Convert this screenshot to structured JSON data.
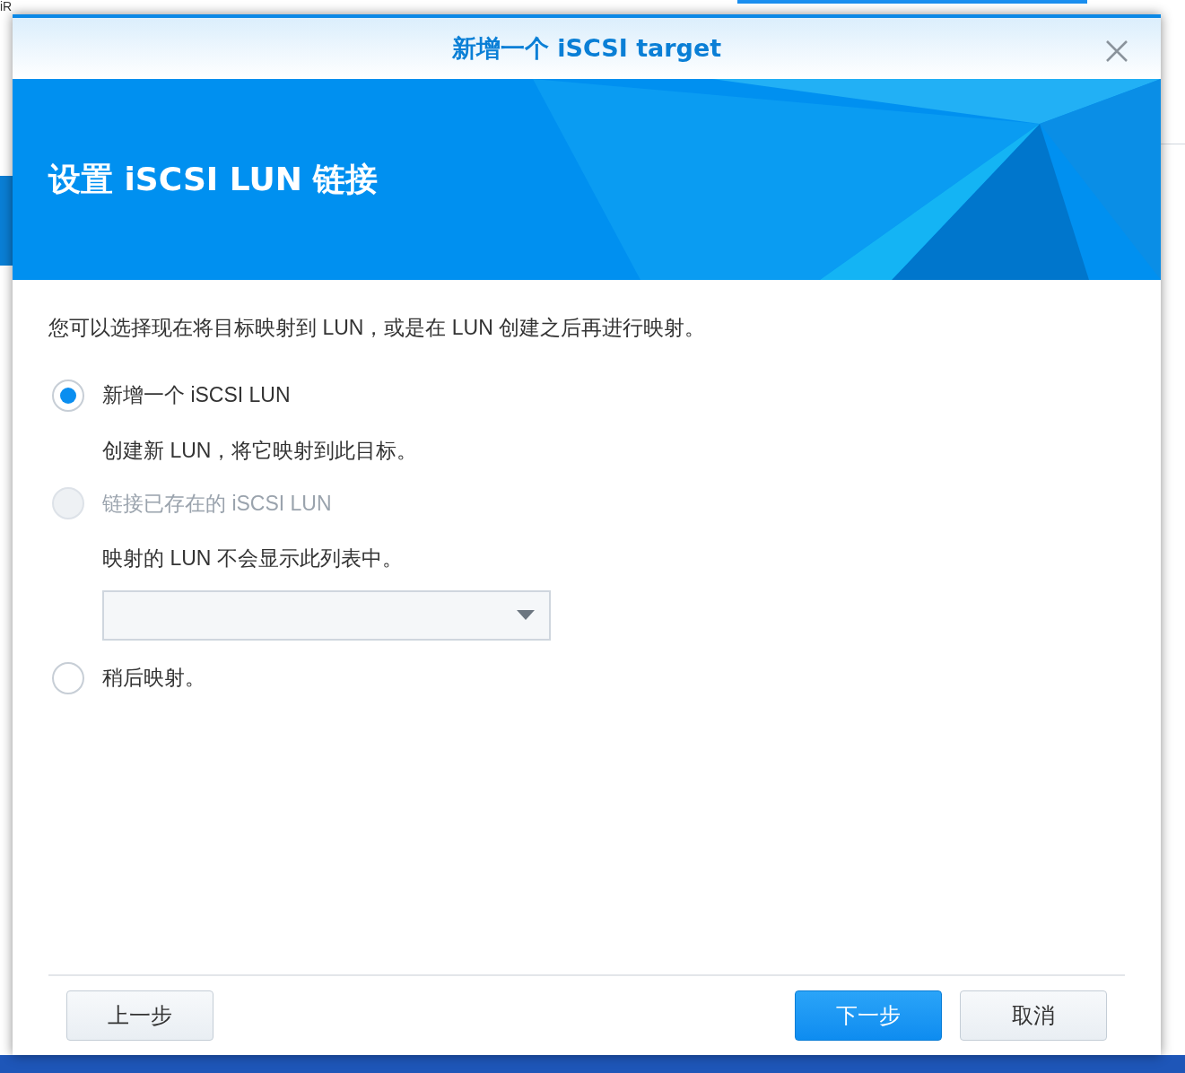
{
  "background": {
    "text": "iR"
  },
  "dialog": {
    "title": "新增一个 iSCSI target",
    "heading": "设置 iSCSI LUN 链接",
    "intro": "您可以选择现在将目标映射到 LUN，或是在 LUN 创建之后再进行映射。",
    "options": [
      {
        "kind": "radio",
        "label": "新增一个 iSCSI LUN",
        "description": "创建新 LUN，将它映射到此目标。",
        "selected": true,
        "disabled": false
      },
      {
        "kind": "radio-select",
        "label": "链接已存在的 iSCSI LUN",
        "description": "映射的 LUN 不会显示此列表中。",
        "selected": false,
        "disabled": true
      },
      {
        "kind": "radio",
        "label": "稍后映射。",
        "selected": false,
        "disabled": false
      }
    ],
    "footer": {
      "left": [
        {
          "label": "上一步",
          "primary": false
        }
      ],
      "right": [
        {
          "label": "下一步",
          "primary": true
        },
        {
          "label": "取消",
          "primary": false
        }
      ]
    }
  }
}
